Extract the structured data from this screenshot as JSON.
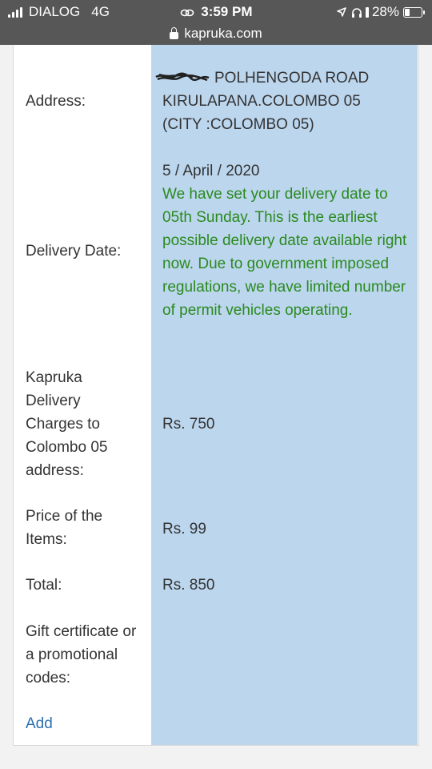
{
  "status_bar": {
    "carrier": "DIALOG",
    "network": "4G",
    "time": "3:59 PM",
    "battery": "28%"
  },
  "browser": {
    "url": "kapruka.com"
  },
  "order": {
    "address": {
      "label": "Address:",
      "line1": "POLHENGODA ROAD",
      "line2": "KIRULAPANA.COLOMBO 05",
      "line3": "(CITY :COLOMBO 05)"
    },
    "delivery_date": {
      "label": "Delivery Date:",
      "date": "5 / April / 2020",
      "note": "We have set your delivery date to 05th Sunday. This is the earliest possible delivery date available right now. Due to government imposed regulations, we have limited number of permit vehicles operating."
    },
    "delivery_charges": {
      "label": "Kapruka Delivery Charges to Colombo 05 address:",
      "value": "Rs. 750"
    },
    "price_of_items": {
      "label": "Price of the Items:",
      "value": "Rs. 99"
    },
    "total": {
      "label": "Total:",
      "value": "Rs. 850"
    },
    "gift_certificate": {
      "label": "Gift certificate or a promotional codes:",
      "link": "Add"
    }
  },
  "colors": {
    "status_bar_bg": "#575757",
    "value_column_bg": "#bcd6ee",
    "note_green": "#2a8a1e",
    "link_blue": "#2f6fae"
  }
}
